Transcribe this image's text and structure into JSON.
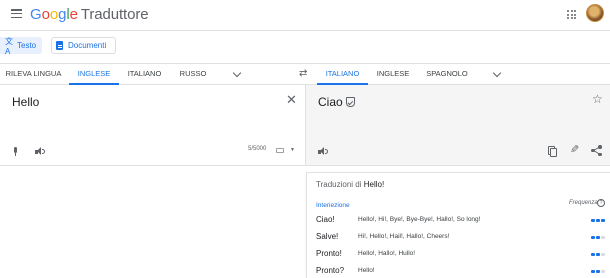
{
  "header": {
    "logo_letters": [
      "G",
      "o",
      "o",
      "g",
      "l",
      "e"
    ],
    "app_name": "Traduttore",
    "brand_colors": [
      "#4285f4",
      "#ea4335",
      "#fbbc05",
      "#4285f4",
      "#34a853",
      "#ea4335"
    ],
    "menu_icon": "hamburger-menu-icon",
    "apps_icon": "apps-grid-icon",
    "avatar_icon": "user-avatar"
  },
  "modes": {
    "text_label": "Testo",
    "documents_label": "Documenti",
    "text_icon": "translate-icon",
    "documents_icon": "document-icon"
  },
  "source_langs": {
    "tabs": [
      "RILEVA LINGUA",
      "INGLESE",
      "ITALIANO",
      "RUSSO"
    ],
    "selected": "INGLESE"
  },
  "target_langs": {
    "tabs": [
      "ITALIANO",
      "INGLESE",
      "SPAGNOLO"
    ],
    "selected": "ITALIANO"
  },
  "source": {
    "text": "Hello",
    "char_count": "5/5000",
    "clear_icon": "close-icon",
    "mic_icon": "microphone-icon",
    "listen_icon": "speaker-icon",
    "keyboard_icon": "keyboard-icon"
  },
  "target": {
    "text": "Ciao",
    "verified_icon": "shield-check-icon",
    "star_icon": "star-outline-icon",
    "copy_icon": "copy-icon",
    "edit_icon": "pencil-icon",
    "share_icon": "share-icon"
  },
  "dictionary": {
    "title_prefix": "Traduzioni di",
    "title_word": "Hello!",
    "part_of_speech": "Interiezione",
    "frequency_label": "Frequenza",
    "frequency_help_icon": "help-circle-icon",
    "entries": [
      {
        "word": "Ciao!",
        "translations": "Hello!, Hi!, Bye!, Bye-Bye!, Hallo!, So long!",
        "frequency": 3
      },
      {
        "word": "Salve!",
        "translations": "Hi!, Hello!, Hail!, Hallo!, Cheers!",
        "frequency": 2
      },
      {
        "word": "Pronto!",
        "translations": "Hello!, Hallo!, Hullo!",
        "frequency": 2
      },
      {
        "word": "Pronto?",
        "translations": "Hello!",
        "frequency": 2
      }
    ]
  },
  "colors": {
    "accent": "#1a73e8",
    "target_background": "#f5f5f5",
    "frequency_inactive": "#dadce0"
  }
}
